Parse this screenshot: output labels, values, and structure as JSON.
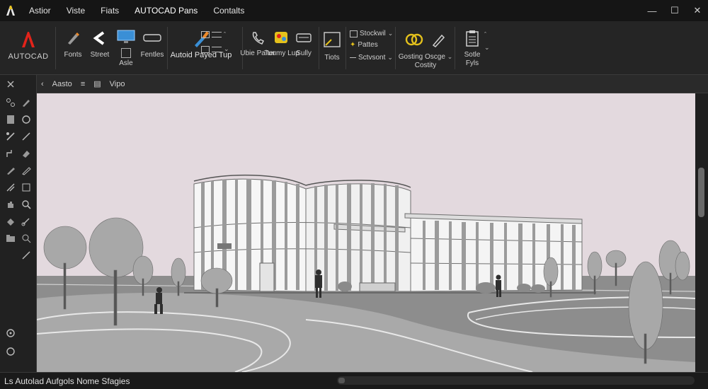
{
  "menu": {
    "items": [
      "Astior",
      "Viste",
      "Fiats",
      "AUTOCAD Pans",
      "Contalts"
    ],
    "active_index": 3
  },
  "window_controls": {
    "close_glyph": "✕",
    "minimize_glyph": "—",
    "maximize_glyph": "☐"
  },
  "ribbon": {
    "brand_label": "AUTOCAD",
    "brand_color": "#e2231a",
    "groups": {
      "fonts_label": "Fonts",
      "street_label": "Street",
      "asle_label": "Asle",
      "fentles_label": "Fentles",
      "autoid_label": "Autoid Payed Tup",
      "ubie_label": "Ubie Palter",
      "tuumy_label": "Tuumy Lup",
      "sully_label": "Sully",
      "tiots_label": "Tiots",
      "stockwil_label": "Stockwil",
      "pattes_label": "Pattes",
      "sctvsont_label": "Sctvsont",
      "gosting_label": "Gosting Oscge",
      "costity_label": "Costity",
      "sotle_label": "Sotle",
      "fyls_label": "Fyls"
    },
    "accent_yellow": "#e4c11c",
    "accent_blue": "#3a8fd6",
    "accent_orange": "#ee8a2a"
  },
  "viewbar": {
    "items": [
      "Aasto",
      "Vipo"
    ]
  },
  "statusbar": {
    "text": "Ls Autolad Aufgols Nome Sfagies"
  },
  "viewport": {
    "background_color": "#e3d9de",
    "ground_color": "#8c8c8c"
  }
}
